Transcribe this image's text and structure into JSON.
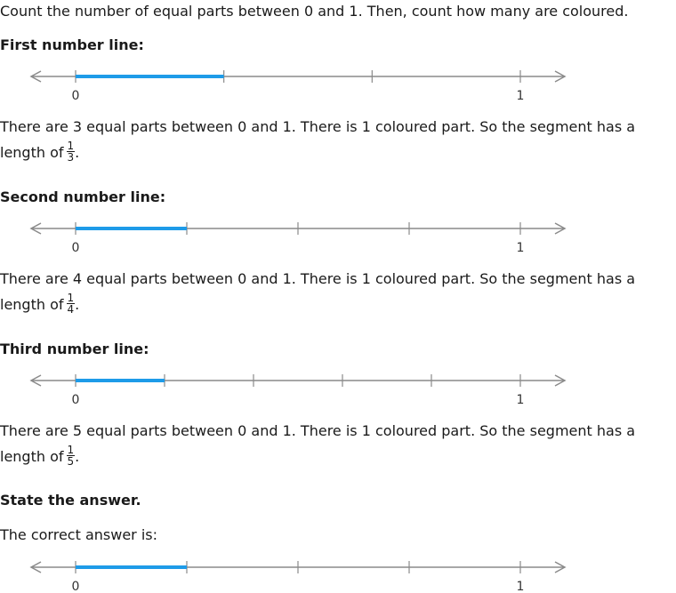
{
  "intro": "Count the number of equal parts between 0 and 1. Then, count how many are coloured.",
  "sections": [
    {
      "heading": "First number line:",
      "line": {
        "parts": 3,
        "coloured_parts": 1,
        "start_label": "0",
        "end_label": "1"
      },
      "explanation": "There are 3 equal parts between 0 and 1. There is 1 coloured part. So the segment has a",
      "length_prefix": "length of",
      "fraction": {
        "numerator": "1",
        "denominator": "3"
      }
    },
    {
      "heading": "Second number line:",
      "line": {
        "parts": 4,
        "coloured_parts": 1,
        "start_label": "0",
        "end_label": "1"
      },
      "explanation": "There are 4 equal parts between 0 and 1. There is 1 coloured part. So the segment has a",
      "length_prefix": "length of",
      "fraction": {
        "numerator": "1",
        "denominator": "4"
      }
    },
    {
      "heading": "Third number line:",
      "line": {
        "parts": 5,
        "coloured_parts": 1,
        "start_label": "0",
        "end_label": "1"
      },
      "explanation": "There are 5 equal parts between 0 and 1. There is 1 coloured part. So the segment has a",
      "length_prefix": "length of",
      "fraction": {
        "numerator": "1",
        "denominator": "5"
      }
    }
  ],
  "answer": {
    "heading": "State the answer.",
    "text": "The correct answer is:",
    "line": {
      "parts": 4,
      "coloured_parts": 1,
      "start_label": "0",
      "end_label": "1"
    }
  },
  "colors": {
    "axis": "#8a8a8a",
    "segment": "#1e9be8",
    "text": "#1a1a1a"
  }
}
